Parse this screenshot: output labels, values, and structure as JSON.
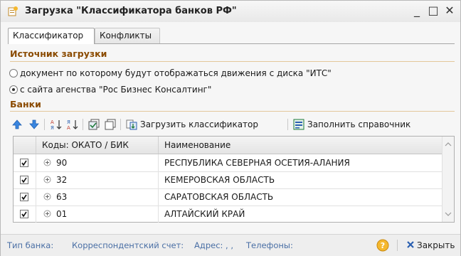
{
  "window": {
    "title": "Загрузка \"Классификатора банков РФ\"",
    "controls": {
      "minimize": "_",
      "maximize": "□",
      "close": "✕"
    }
  },
  "tabs": [
    {
      "label": "Классификатор",
      "active": true
    },
    {
      "label": "Конфликты",
      "active": false
    }
  ],
  "source": {
    "title": "Источник загрузки",
    "options": [
      {
        "label": "документ по которому будут отображаться движения с диска \"ИТС\"",
        "selected": false
      },
      {
        "label": "с сайта агенства \"Рос Бизнес Консалтинг\"",
        "selected": true
      }
    ]
  },
  "banks": {
    "title": "Банки",
    "toolbar": {
      "load_label": "Загрузить классификатор",
      "fill_label": "Заполнить справочник"
    },
    "columns": [
      "Коды: ОКАТО / БИК",
      "Наименование"
    ],
    "rows": [
      {
        "checked": true,
        "code": "90",
        "name": "РЕСПУБЛИКА СЕВЕРНАЯ ОСЕТИЯ-АЛАНИЯ"
      },
      {
        "checked": true,
        "code": "32",
        "name": "КЕМЕРОВСКАЯ ОБЛАСТЬ"
      },
      {
        "checked": true,
        "code": "63",
        "name": "САРАТОВСКАЯ ОБЛАСТЬ"
      },
      {
        "checked": true,
        "code": "01",
        "name": "АЛТАЙСКИЙ КРАЙ"
      }
    ]
  },
  "statusbar": {
    "bank_type": "Тип банка:",
    "corr_account": "Корреспондентский счет:",
    "address": "Адрес:  , ,",
    "phones": "Телефоны:",
    "close_label": "Закрыть"
  },
  "colors": {
    "section_title": "#8a4a00",
    "status_link": "#4a6fa5",
    "arrow_up": "#2a6fcf",
    "arrow_down": "#2a6fcf",
    "fill_icon": "#1f7a3a",
    "help": "#f0a020"
  }
}
